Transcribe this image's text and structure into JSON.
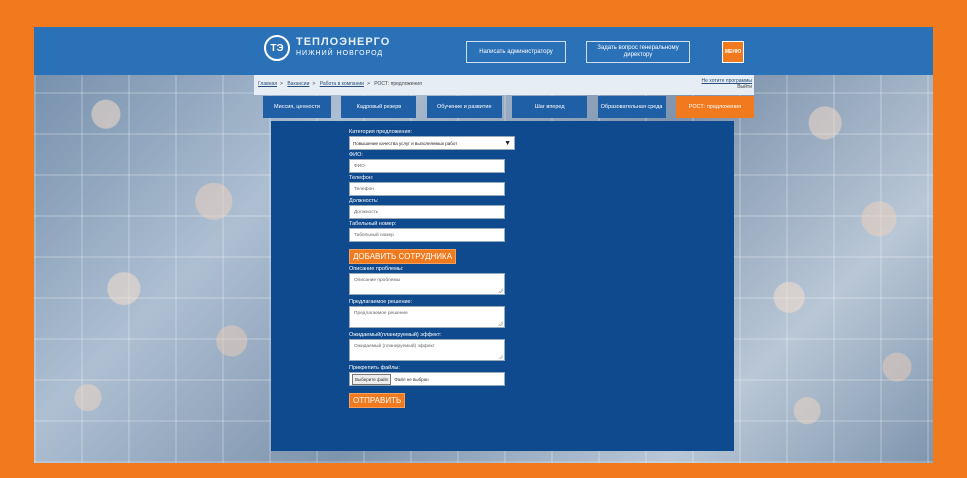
{
  "header": {
    "logo_mark": "ТЭ",
    "logo_line1": "ТЕПЛОЭНЕРГО",
    "logo_line2": "НИЖНИЙ НОВГОРОД",
    "btn_admin": "Написать администратору",
    "btn_director": "Задать вопрос генеральному директору",
    "menu_label": "МЕНЮ"
  },
  "breadcrumb": {
    "items": [
      "Главная",
      "Вакансии",
      "Работа в компании",
      "РОСТ: предложения"
    ],
    "right_line1": "Не хотите программы",
    "right_line2": "Выйти"
  },
  "tabs": [
    {
      "label": "Миссия, ценности"
    },
    {
      "label": "Кадровый резерв"
    },
    {
      "label": "Обучение и развитие"
    },
    {
      "label": "Шаг вперед"
    },
    {
      "label": "Образовательная среда"
    },
    {
      "label": "РОСТ: предложения"
    }
  ],
  "form": {
    "category_label": "Категория предложения:",
    "category_value": "Повышение качества услуг и выполняемых работ",
    "fio_label": "ФИО:",
    "fio_placeholder": "ФИО",
    "phone_label": "Телефон:",
    "phone_placeholder": "Телефон",
    "position_label": "Должность:",
    "position_placeholder": "Должность",
    "tab_number_label": "Табельный номер:",
    "tab_number_placeholder": "Табельный номер",
    "add_employee": "ДОБАВИТЬ СОТРУДНИКА",
    "problem_label": "Описание проблемы:",
    "problem_placeholder": "Описание проблемы",
    "solution_label": "Предлагаемое решение:",
    "solution_placeholder": "Предлагаемое решение",
    "effect_label": "Ожидаемый(планируемый) эффект:",
    "effect_placeholder": "Ожидаемый (планируемый) эффект",
    "attach_label": "Прикрепить файлы:",
    "choose_file": "Выберите файл",
    "no_file": "Файл не выбран",
    "submit": "ОТПРАВИТЬ"
  },
  "colors": {
    "accent": "#f27a1e",
    "header_blue": "#2a71b8",
    "panel_blue": "#0e4a8d",
    "tab_blue": "#1f5fa6"
  }
}
